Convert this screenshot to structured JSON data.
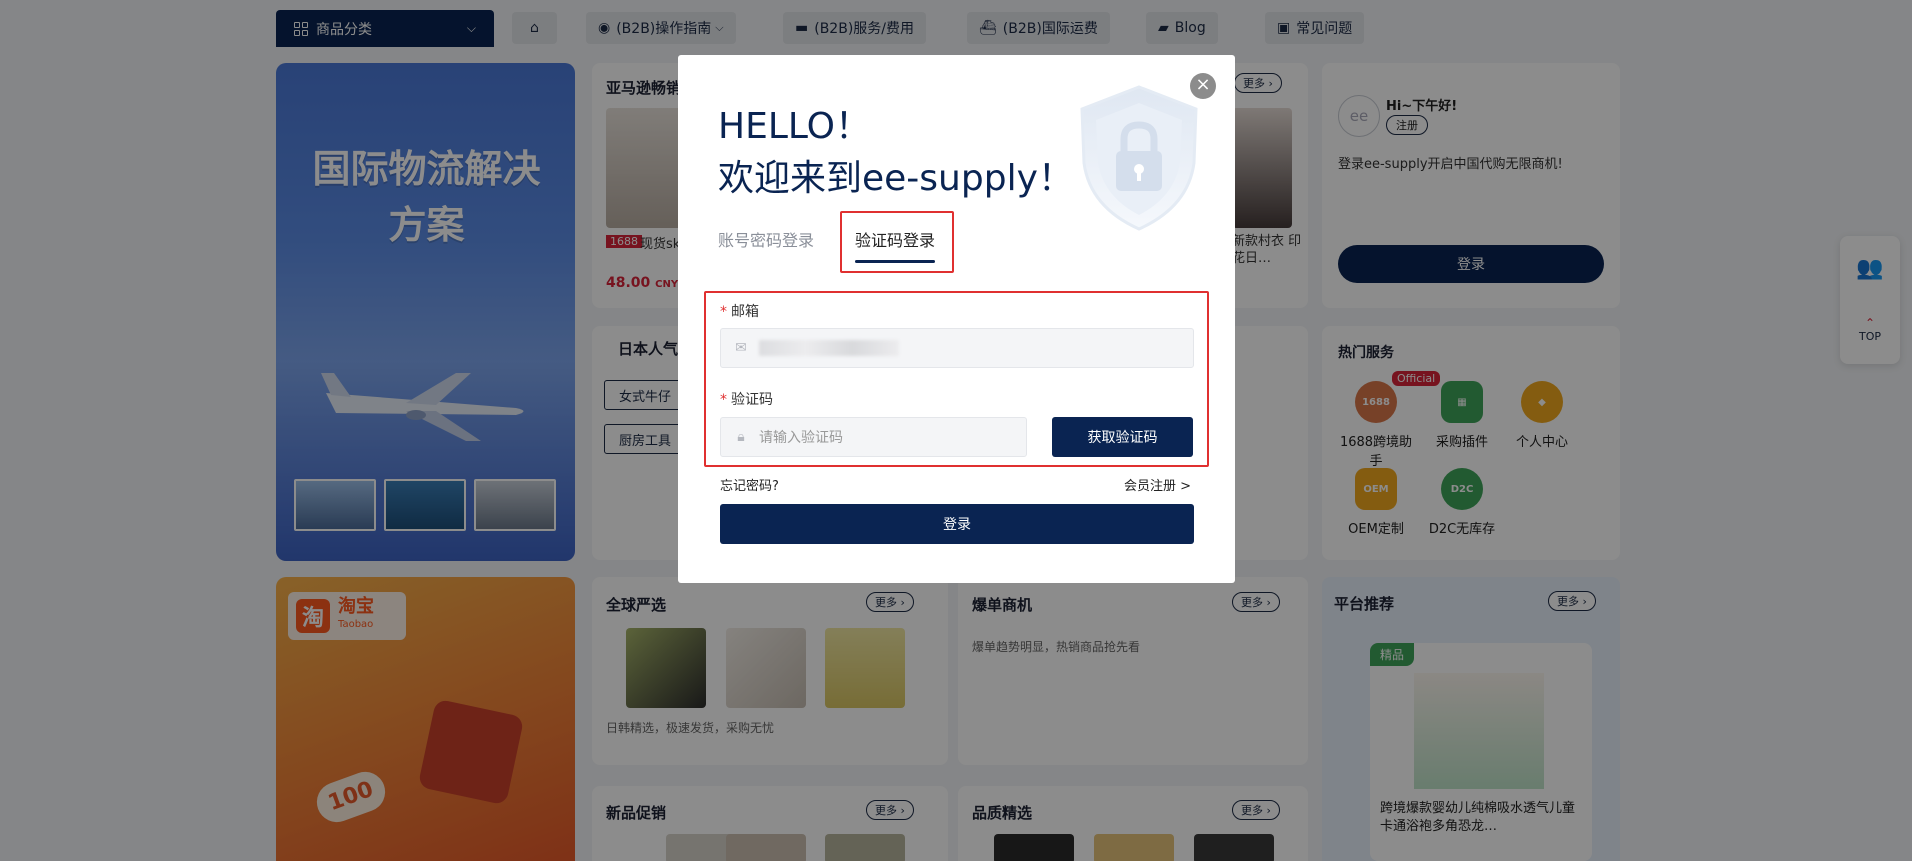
{
  "nav": {
    "category_label": "商品分类",
    "items": [
      {
        "label": "",
        "icon": "home-icon"
      },
      {
        "label": "(B2B)操作指南",
        "icon": "compass-icon"
      },
      {
        "label": "(B2B)服务/费用",
        "icon": "wallet-icon"
      },
      {
        "label": "(B2B)国际运费",
        "icon": "ship-icon"
      },
      {
        "label": "Blog",
        "icon": "blog-icon"
      },
      {
        "label": "常见问题",
        "icon": "faq-icon"
      }
    ]
  },
  "banner1": {
    "title": "国际物流解决方案"
  },
  "banner2": {
    "brand": "淘宝",
    "brand_en": "Taobao",
    "badge": "淘",
    "price_tag": "100"
  },
  "amazon_section": {
    "title": "亚马逊畅销",
    "more": "更多",
    "item_badge": "1688",
    "item_title": "现货sk… 莫代尔弹力…",
    "item_price": "48.00",
    "item_currency": "CNY",
    "item2_title": "新款村衣 印花日…"
  },
  "japan_section": {
    "title": "日本人气",
    "tags": [
      "女式牛仔",
      "厨房工具"
    ]
  },
  "global_section": {
    "title": "全球严选",
    "more": "更多",
    "desc": "日韩精选，极速发货，采购无忧"
  },
  "hot_orders": {
    "title": "爆单商机",
    "more": "更多",
    "desc": "爆单趋势明显，热销商品抢先看"
  },
  "new_promo": {
    "title": "新品促销",
    "more": "更多"
  },
  "quality": {
    "title": "品质精选",
    "more": "更多"
  },
  "side_login": {
    "greeting": "Hi~下午好!",
    "register": "注册",
    "desc": "登录ee-supply开启中国代购无限商机!",
    "login": "登录",
    "avatar": "ee"
  },
  "hot_services": {
    "title": "热门服务",
    "official_badge": "Official",
    "items": [
      {
        "label": "1688跨境助手",
        "icon_text": "1688"
      },
      {
        "label": "采购插件",
        "icon_text": ""
      },
      {
        "label": "个人中心",
        "icon_text": ""
      },
      {
        "label": "OEM定制",
        "icon_text": "OEM"
      },
      {
        "label": "D2C无库存",
        "icon_text": "D2C"
      }
    ]
  },
  "platform": {
    "title": "平台推荐",
    "more": "更多",
    "badge": "精品",
    "item_title": "跨境爆款婴幼儿纯棉吸水透气儿童卡通浴袍多角恐龙…"
  },
  "float_panel": {
    "top_label": "TOP"
  },
  "modal": {
    "hello": "HELLO！",
    "welcome": "欢迎来到ee-supply！",
    "tab_password": "账号密码登录",
    "tab_code": "验证码登录",
    "email_label": "邮箱",
    "code_label": "验证码",
    "code_placeholder": "请输入验证码",
    "get_code": "获取验证码",
    "forgot": "忘记密码?",
    "register": "会员注册 >",
    "login": "登录",
    "close": "×"
  },
  "colors": {
    "brand": "#0a2452",
    "highlight": "#e03030"
  }
}
